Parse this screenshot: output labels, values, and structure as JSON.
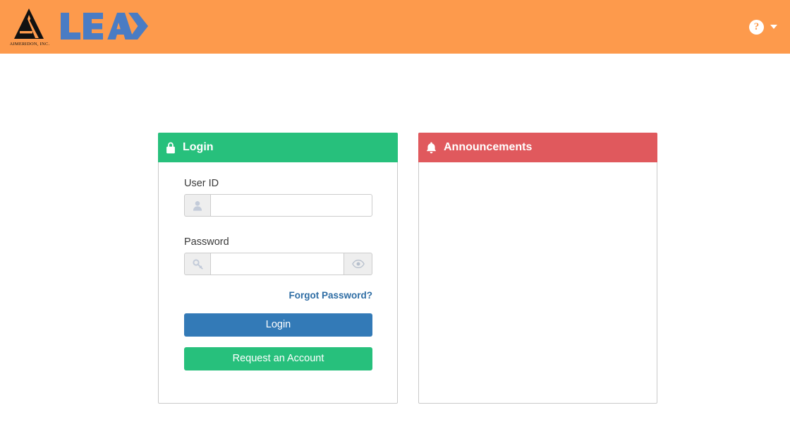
{
  "header": {
    "logo_company": "AIMERIDON, INC.",
    "logo_wordmark": "LEAD",
    "help_label": "?",
    "help_icon": "question-circle-icon",
    "caret_icon": "chevron-down-icon"
  },
  "login_panel": {
    "icon": "lock-icon",
    "title": "Login",
    "user_id": {
      "label": "User ID",
      "value": "",
      "placeholder": "",
      "addon_icon": "user-icon"
    },
    "password": {
      "label": "Password",
      "value": "",
      "placeholder": "",
      "addon_icon": "key-icon",
      "toggle_icon": "eye-icon"
    },
    "forgot_password_label": "Forgot Password?",
    "login_button_label": "Login",
    "request_account_button_label": "Request an Account"
  },
  "announcements_panel": {
    "icon": "bell-icon",
    "title": "Announcements",
    "items": []
  },
  "colors": {
    "header_orange": "#fd9a4c",
    "panel_green": "#27c07c",
    "panel_red": "#e0595d",
    "login_blue": "#337ab7",
    "link_blue": "#2e6da4",
    "logo_blue": "#4a7cc4"
  }
}
